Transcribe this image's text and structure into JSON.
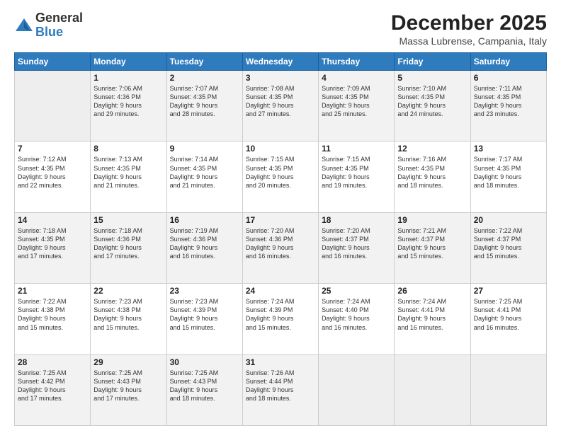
{
  "logo": {
    "general": "General",
    "blue": "Blue"
  },
  "title": "December 2025",
  "location": "Massa Lubrense, Campania, Italy",
  "days_of_week": [
    "Sunday",
    "Monday",
    "Tuesday",
    "Wednesday",
    "Thursday",
    "Friday",
    "Saturday"
  ],
  "weeks": [
    [
      {
        "day": "",
        "info": ""
      },
      {
        "day": "1",
        "info": "Sunrise: 7:06 AM\nSunset: 4:36 PM\nDaylight: 9 hours\nand 29 minutes."
      },
      {
        "day": "2",
        "info": "Sunrise: 7:07 AM\nSunset: 4:35 PM\nDaylight: 9 hours\nand 28 minutes."
      },
      {
        "day": "3",
        "info": "Sunrise: 7:08 AM\nSunset: 4:35 PM\nDaylight: 9 hours\nand 27 minutes."
      },
      {
        "day": "4",
        "info": "Sunrise: 7:09 AM\nSunset: 4:35 PM\nDaylight: 9 hours\nand 25 minutes."
      },
      {
        "day": "5",
        "info": "Sunrise: 7:10 AM\nSunset: 4:35 PM\nDaylight: 9 hours\nand 24 minutes."
      },
      {
        "day": "6",
        "info": "Sunrise: 7:11 AM\nSunset: 4:35 PM\nDaylight: 9 hours\nand 23 minutes."
      }
    ],
    [
      {
        "day": "7",
        "info": "Sunrise: 7:12 AM\nSunset: 4:35 PM\nDaylight: 9 hours\nand 22 minutes."
      },
      {
        "day": "8",
        "info": "Sunrise: 7:13 AM\nSunset: 4:35 PM\nDaylight: 9 hours\nand 21 minutes."
      },
      {
        "day": "9",
        "info": "Sunrise: 7:14 AM\nSunset: 4:35 PM\nDaylight: 9 hours\nand 21 minutes."
      },
      {
        "day": "10",
        "info": "Sunrise: 7:15 AM\nSunset: 4:35 PM\nDaylight: 9 hours\nand 20 minutes."
      },
      {
        "day": "11",
        "info": "Sunrise: 7:15 AM\nSunset: 4:35 PM\nDaylight: 9 hours\nand 19 minutes."
      },
      {
        "day": "12",
        "info": "Sunrise: 7:16 AM\nSunset: 4:35 PM\nDaylight: 9 hours\nand 18 minutes."
      },
      {
        "day": "13",
        "info": "Sunrise: 7:17 AM\nSunset: 4:35 PM\nDaylight: 9 hours\nand 18 minutes."
      }
    ],
    [
      {
        "day": "14",
        "info": "Sunrise: 7:18 AM\nSunset: 4:35 PM\nDaylight: 9 hours\nand 17 minutes."
      },
      {
        "day": "15",
        "info": "Sunrise: 7:18 AM\nSunset: 4:36 PM\nDaylight: 9 hours\nand 17 minutes."
      },
      {
        "day": "16",
        "info": "Sunrise: 7:19 AM\nSunset: 4:36 PM\nDaylight: 9 hours\nand 16 minutes."
      },
      {
        "day": "17",
        "info": "Sunrise: 7:20 AM\nSunset: 4:36 PM\nDaylight: 9 hours\nand 16 minutes."
      },
      {
        "day": "18",
        "info": "Sunrise: 7:20 AM\nSunset: 4:37 PM\nDaylight: 9 hours\nand 16 minutes."
      },
      {
        "day": "19",
        "info": "Sunrise: 7:21 AM\nSunset: 4:37 PM\nDaylight: 9 hours\nand 15 minutes."
      },
      {
        "day": "20",
        "info": "Sunrise: 7:22 AM\nSunset: 4:37 PM\nDaylight: 9 hours\nand 15 minutes."
      }
    ],
    [
      {
        "day": "21",
        "info": "Sunrise: 7:22 AM\nSunset: 4:38 PM\nDaylight: 9 hours\nand 15 minutes."
      },
      {
        "day": "22",
        "info": "Sunrise: 7:23 AM\nSunset: 4:38 PM\nDaylight: 9 hours\nand 15 minutes."
      },
      {
        "day": "23",
        "info": "Sunrise: 7:23 AM\nSunset: 4:39 PM\nDaylight: 9 hours\nand 15 minutes."
      },
      {
        "day": "24",
        "info": "Sunrise: 7:24 AM\nSunset: 4:39 PM\nDaylight: 9 hours\nand 15 minutes."
      },
      {
        "day": "25",
        "info": "Sunrise: 7:24 AM\nSunset: 4:40 PM\nDaylight: 9 hours\nand 16 minutes."
      },
      {
        "day": "26",
        "info": "Sunrise: 7:24 AM\nSunset: 4:41 PM\nDaylight: 9 hours\nand 16 minutes."
      },
      {
        "day": "27",
        "info": "Sunrise: 7:25 AM\nSunset: 4:41 PM\nDaylight: 9 hours\nand 16 minutes."
      }
    ],
    [
      {
        "day": "28",
        "info": "Sunrise: 7:25 AM\nSunset: 4:42 PM\nDaylight: 9 hours\nand 17 minutes."
      },
      {
        "day": "29",
        "info": "Sunrise: 7:25 AM\nSunset: 4:43 PM\nDaylight: 9 hours\nand 17 minutes."
      },
      {
        "day": "30",
        "info": "Sunrise: 7:25 AM\nSunset: 4:43 PM\nDaylight: 9 hours\nand 18 minutes."
      },
      {
        "day": "31",
        "info": "Sunrise: 7:26 AM\nSunset: 4:44 PM\nDaylight: 9 hours\nand 18 minutes."
      },
      {
        "day": "",
        "info": ""
      },
      {
        "day": "",
        "info": ""
      },
      {
        "day": "",
        "info": ""
      }
    ]
  ]
}
